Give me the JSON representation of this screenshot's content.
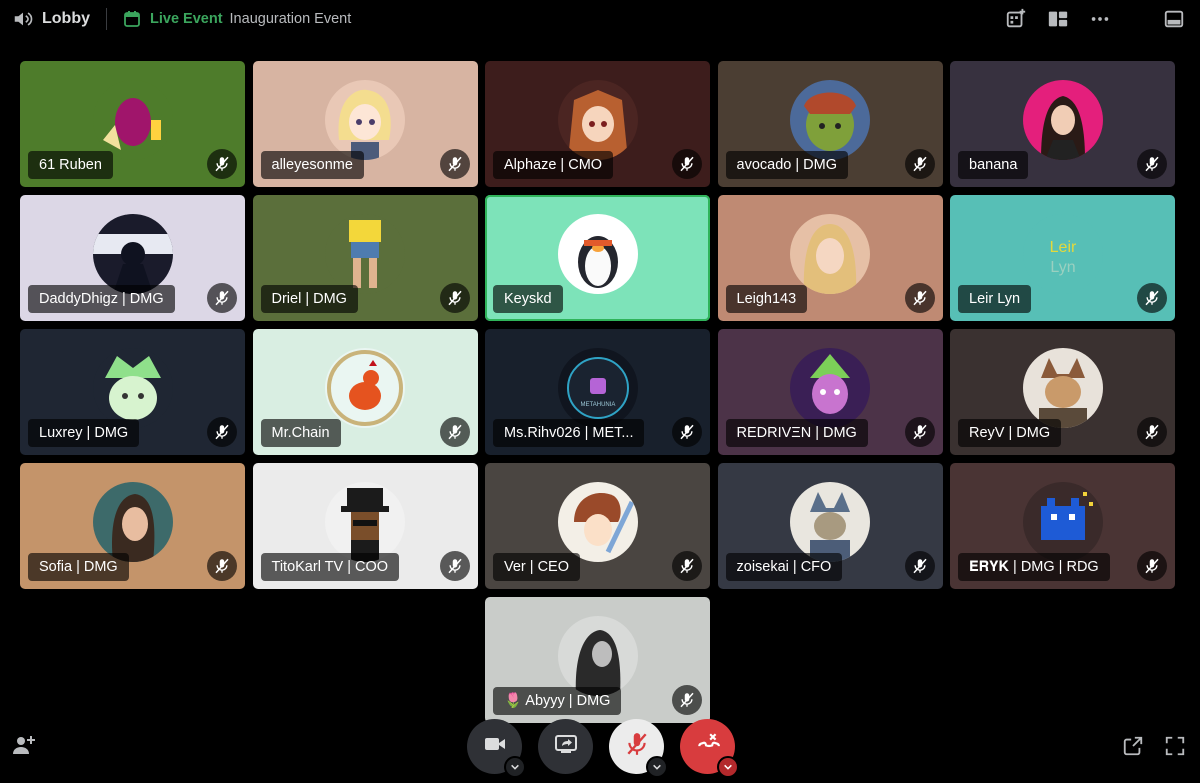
{
  "header": {
    "channel_name": "Lobby",
    "event_status": "Live Event",
    "event_name": "Inauguration Event"
  },
  "tiles": [
    {
      "name": "61 Ruben",
      "bg": "#4e7c2b",
      "avatar": "egg-avatar",
      "muted": true
    },
    {
      "name": "alleyesonme",
      "bg": "#d7b4a2",
      "avatar": "anime-girl-avatar",
      "muted": true
    },
    {
      "name": "Alphaze | CMO",
      "bg": "#3d1d1c",
      "avatar": "anime-fox-girl-avatar",
      "muted": true
    },
    {
      "name": "avocado | DMG",
      "bg": "#4b3e33",
      "avatar": "ogre-avatar",
      "muted": true
    },
    {
      "name": "banana",
      "bg": "#37313f",
      "avatar": "woman-portrait-avatar",
      "muted": true
    },
    {
      "name": "DaddyDhigz | DMG",
      "bg": "#dcd7e6",
      "avatar": "astronaut-avatar",
      "muted": true
    },
    {
      "name": "Driel | DMG",
      "bg": "#5b6f3b",
      "avatar": "legs-avatar",
      "muted": true
    },
    {
      "name": "Keyskd",
      "bg": "#7de3b9",
      "avatar": "penguin-avatar",
      "muted": false,
      "speaking": true
    },
    {
      "name": "Leigh143",
      "bg": "#bf8a73",
      "avatar": "blonde-woman-avatar",
      "muted": true
    },
    {
      "name": "Leir Lyn",
      "bg": "#57bfb6",
      "avatar": "leir-lyn-logo-avatar",
      "muted": true
    },
    {
      "name": "Luxrey | DMG",
      "bg": "#1f2633",
      "avatar": "green-creature-avatar",
      "muted": true
    },
    {
      "name": "Mr.Chain",
      "bg": "#d9eee2",
      "avatar": "rooster-avatar",
      "muted": true
    },
    {
      "name": "Ms.Rihv026 | MET...",
      "bg": "#18202c",
      "avatar": "metahunia-logo-avatar",
      "muted": true
    },
    {
      "name": "REDRIVΞN | DMG",
      "bg": "#4c3348",
      "avatar": "punk-robot-avatar",
      "muted": true
    },
    {
      "name": "ReyV | DMG",
      "bg": "#3a3130",
      "avatar": "samurai-cat-avatar",
      "muted": true
    },
    {
      "name": "Sofia | DMG",
      "bg": "#c4946a",
      "avatar": "ponytail-woman-avatar",
      "muted": true
    },
    {
      "name": "TitoKarl TV | COO",
      "bg": "#ebebeb",
      "avatar": "pixel-top-hat-avatar",
      "muted": true
    },
    {
      "name": "Ver | CEO",
      "bg": "#4a4541",
      "avatar": "anime-swordsman-avatar",
      "muted": true
    },
    {
      "name": "zoisekai | CFO",
      "bg": "#353944",
      "avatar": "armored-cat-avatar",
      "muted": true
    },
    {
      "name": "𝐄𝐑𝐘𝐊 | DMG | RDG",
      "bg": "#4a3434",
      "avatar": "pixel-blue-monster-avatar",
      "muted": true
    },
    {
      "name": "🌷 Abyyy | DMG",
      "bg": "#c9ccc9",
      "avatar": "hooded-figure-avatar",
      "muted": true
    }
  ],
  "controls": {
    "camera": "camera-icon",
    "screen_share": "screen-share-icon",
    "microphone": "microphone-muted-icon",
    "disconnect": "disconnect-icon"
  },
  "colors": {
    "accent_green": "#3ba55d",
    "speaking_border": "#2fb45a",
    "disconnect_red": "#d83c3e"
  }
}
